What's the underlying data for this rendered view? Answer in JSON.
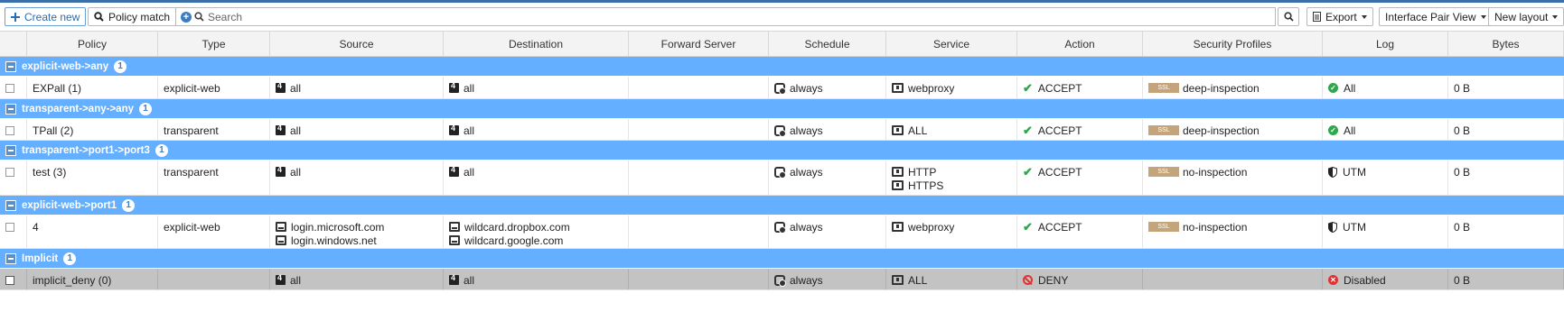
{
  "toolbar": {
    "create_new": "Create new",
    "policy_match": "Policy match",
    "search_placeholder": "Search",
    "export": "Export",
    "interface_pair_view": "Interface Pair View",
    "new_layout": "New layout"
  },
  "columns": [
    "Policy",
    "Type",
    "Source",
    "Destination",
    "Forward Server",
    "Schedule",
    "Service",
    "Action",
    "Security Profiles",
    "Log",
    "Bytes"
  ],
  "groups": [
    {
      "title": "explicit-web->any",
      "count": "1",
      "rows": [
        {
          "policy": "EXPall (1)",
          "type": "explicit-web",
          "source": [
            "all"
          ],
          "destination": [
            "all"
          ],
          "forward_server": "",
          "schedule": "always",
          "service": [
            "webproxy"
          ],
          "action": "ACCEPT",
          "ssl": "SSL",
          "profile": "deep-inspection",
          "log": "All",
          "bytes": "0 B"
        }
      ]
    },
    {
      "title": "transparent->any->any",
      "count": "1",
      "rows": [
        {
          "policy": "TPall (2)",
          "type": "transparent",
          "source": [
            "all"
          ],
          "destination": [
            "all"
          ],
          "forward_server": "",
          "schedule": "always",
          "service": [
            "ALL"
          ],
          "action": "ACCEPT",
          "ssl": "SSL",
          "profile": "deep-inspection",
          "log": "All",
          "bytes": "0 B"
        }
      ]
    },
    {
      "title": "transparent->port1->port3",
      "count": "1",
      "rows": [
        {
          "policy": "test (3)",
          "type": "transparent",
          "source": [
            "all"
          ],
          "destination": [
            "all"
          ],
          "forward_server": "",
          "schedule": "always",
          "service": [
            "HTTP",
            "HTTPS"
          ],
          "action": "ACCEPT",
          "ssl": "SSL",
          "profile": "no-inspection",
          "log": "UTM",
          "bytes": "0 B"
        }
      ]
    },
    {
      "title": "explicit-web->port1",
      "count": "1",
      "rows": [
        {
          "policy": "4",
          "type": "explicit-web",
          "source": [
            "login.microsoft.com",
            "login.windows.net"
          ],
          "destination": [
            "wildcard.dropbox.com",
            "wildcard.google.com"
          ],
          "forward_server": "",
          "schedule": "always",
          "service": [
            "webproxy"
          ],
          "action": "ACCEPT",
          "ssl": "SSL",
          "profile": "no-inspection",
          "log": "UTM",
          "bytes": "0 B"
        }
      ]
    },
    {
      "title": "Implicit",
      "count": "1",
      "rows": [
        {
          "policy": "implicit_deny (0)",
          "type": "",
          "source": [
            "all"
          ],
          "destination": [
            "all"
          ],
          "forward_server": "",
          "schedule": "always",
          "service": [
            "ALL"
          ],
          "action": "DENY",
          "ssl": "",
          "profile": "",
          "log": "Disabled",
          "bytes": "0 B"
        }
      ]
    }
  ]
}
